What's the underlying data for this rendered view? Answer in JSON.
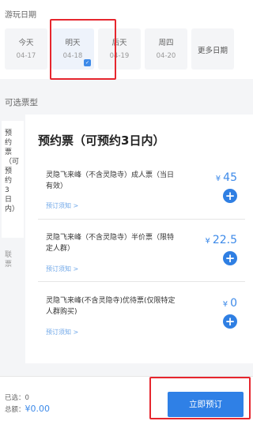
{
  "date_section": {
    "title": "游玩日期",
    "cards": [
      {
        "day": "今天",
        "date": "04-17"
      },
      {
        "day": "明天",
        "date": "04-18"
      },
      {
        "day": "后天",
        "date": "04-19"
      },
      {
        "day": "周四",
        "date": "04-20"
      },
      {
        "day": "更多日期"
      }
    ],
    "selected_check": "✓"
  },
  "ticket_section": {
    "title": "可选票型",
    "side_nav": [
      "预约票（可预约3日内）",
      "联票"
    ],
    "group_title": "预约票（可预约3日内）",
    "tickets": [
      {
        "name": "灵隐飞来峰（不含灵隐寺）成人票（当日有效）",
        "currency": "¥",
        "price": "45",
        "notice": "预订须知 >",
        "add_icon": "+"
      },
      {
        "name": "灵隐飞来峰（不含灵隐寺）半价票（限特定人群）",
        "currency": "¥",
        "price": "22.5",
        "notice": "预订须知 >",
        "add_icon": "+"
      },
      {
        "name": "灵隐飞来峰(不含灵隐寺)优待票(仅限特定人群购买)",
        "currency": "¥",
        "price": "0",
        "notice": "预订须知 >",
        "add_icon": "+"
      }
    ],
    "next_group_title": "联票"
  },
  "bottom_bar": {
    "selected_label": "已选：",
    "selected_value": "0",
    "total_label": "总额：",
    "total_value": "¥0.00",
    "book_button": "立即预订"
  },
  "colors": {
    "accent": "#2f80e6",
    "highlight": "#e6262e"
  }
}
